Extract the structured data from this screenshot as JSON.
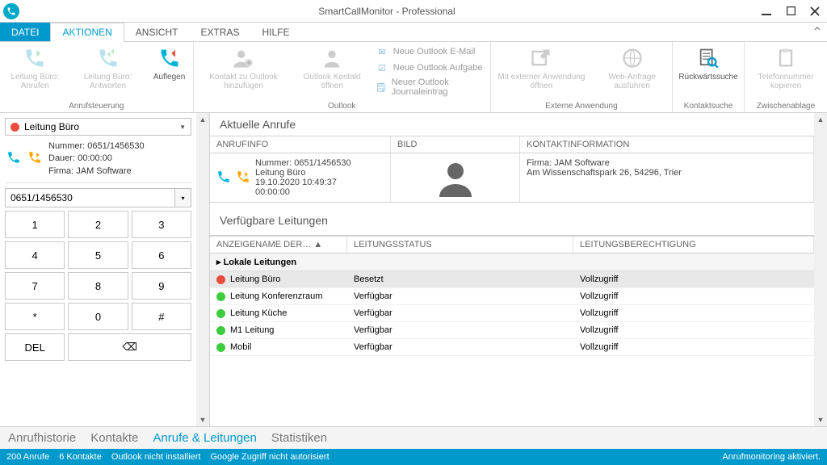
{
  "window": {
    "title": "SmartCallMonitor - Professional"
  },
  "menu": {
    "file": "DATEI",
    "tabs": [
      "AKTIONEN",
      "ANSICHT",
      "EXTRAS",
      "HILFE"
    ],
    "active": "AKTIONEN"
  },
  "ribbon": {
    "groups": {
      "anrufsteuerung": {
        "label": "Anrufsteuerung",
        "items": [
          {
            "label": "Leitung Büro: Anrufen",
            "disabled": true
          },
          {
            "label": "Leitung Büro: Antworten",
            "disabled": true
          },
          {
            "label": "Auflegen",
            "disabled": false
          }
        ]
      },
      "outlook": {
        "label": "Outlook",
        "bigItems": [
          {
            "label": "Kontakt zu Outlook hinzufügen",
            "disabled": true
          },
          {
            "label": "Outlook Kontakt öffnen",
            "disabled": true
          }
        ],
        "stack": [
          "Neue Outlook E-Mail",
          "Neue Outlook Aufgabe",
          "Neuer Outlook Journaleintrag"
        ]
      },
      "externe": {
        "label": "Externe Anwendung",
        "items": [
          {
            "label": "Mit externer Anwendung öffnen",
            "disabled": true
          },
          {
            "label": "Web-Anfrage ausführen",
            "disabled": true
          }
        ]
      },
      "kontaktsuche": {
        "label": "Kontaktsuche",
        "items": [
          {
            "label": "Rückwärtssuche",
            "disabled": false
          }
        ]
      },
      "zwischenablage": {
        "label": "Zwischenablage",
        "items": [
          {
            "label": "Telefonnummer kopieren",
            "disabled": true
          }
        ]
      }
    }
  },
  "left": {
    "line": "Leitung Büro",
    "summary": {
      "number_label": "Nummer:",
      "number": "0651/1456530",
      "duration_label": "Dauer:",
      "duration": "00:00:00",
      "company_label": "Firma:",
      "company": "JAM Software"
    },
    "dial_value": "0651/1456530",
    "keys": [
      "1",
      "2",
      "3",
      "4",
      "5",
      "6",
      "7",
      "8",
      "9",
      "*",
      "0",
      "#",
      "DEL",
      "⌫"
    ]
  },
  "main": {
    "current_calls_title": "Aktuelle Anrufe",
    "columns": {
      "info": "ANRUFINFO",
      "pic": "BILD",
      "contact": "KONTAKTINFORMATION"
    },
    "call": {
      "number_label": "Nummer:",
      "number": "0651/1456530",
      "line": "Leitung Büro",
      "timestamp": "19.10.2020 10:49:37",
      "duration": "00:00:00",
      "contact_company_label": "Firma:",
      "contact_company": "JAM Software",
      "contact_address": "Am Wissenschaftspark 26, 54296, Trier"
    },
    "available_lines_title": "Verfügbare Leitungen",
    "line_columns": {
      "name": "ANZEIGENAME DER…",
      "status": "LEITUNGSSTATUS",
      "perm": "LEITUNGSBERECHTIGUNG"
    },
    "line_group": "Lokale Leitungen",
    "lines": [
      {
        "name": "Leitung Büro",
        "status": "Besetzt",
        "perm": "Vollzugriff",
        "color": "red"
      },
      {
        "name": "Leitung Konferenzraum",
        "status": "Verfügbar",
        "perm": "Vollzugriff",
        "color": "green"
      },
      {
        "name": "Leitung Küche",
        "status": "Verfügbar",
        "perm": "Vollzugriff",
        "color": "green"
      },
      {
        "name": "M1 Leitung",
        "status": "Verfügbar",
        "perm": "Vollzugriff",
        "color": "green"
      },
      {
        "name": "Mobil",
        "status": "Verfügbar",
        "perm": "Vollzugriff",
        "color": "green"
      }
    ]
  },
  "bottom_tabs": {
    "items": [
      "Anrufhistorie",
      "Kontakte",
      "Anrufe & Leitungen",
      "Statistiken"
    ],
    "active": "Anrufe & Leitungen"
  },
  "statusbar": {
    "calls": "200 Anrufe",
    "contacts": "6 Kontakte",
    "outlook": "Outlook nicht installiert",
    "google": "Google Zugriff nicht autorisiert",
    "monitoring": "Anrufmonitoring aktiviert."
  }
}
